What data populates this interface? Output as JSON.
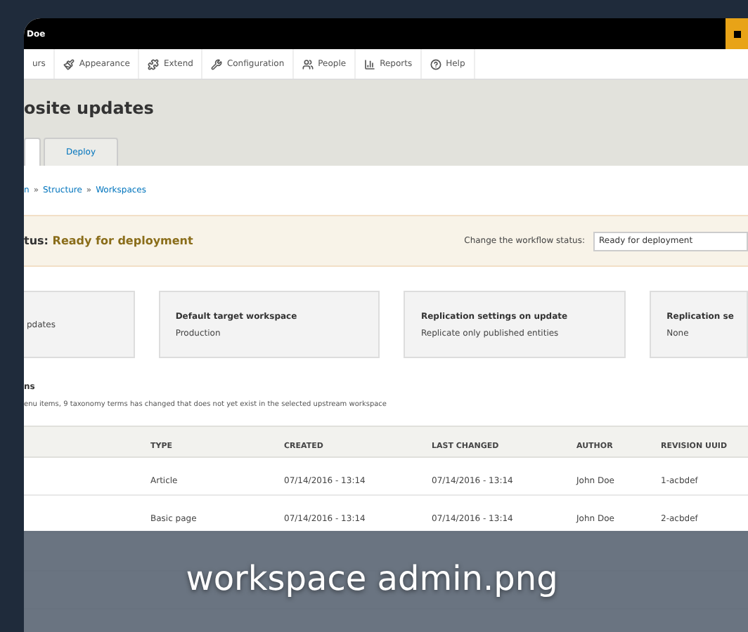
{
  "toolbar": {
    "user": "Doe"
  },
  "menu": [
    {
      "label": "urs"
    },
    {
      "label": "Appearance"
    },
    {
      "label": "Extend"
    },
    {
      "label": "Configuration"
    },
    {
      "label": "People"
    },
    {
      "label": "Reports"
    },
    {
      "label": "Help"
    }
  ],
  "page_title": "osite updates",
  "tabs": [
    {
      "selected": true
    },
    {
      "label": "Deploy",
      "selected": false
    }
  ],
  "breadcrumb": [
    {
      "kind": "link",
      "text": "n"
    },
    {
      "kind": "sep",
      "text": "»"
    },
    {
      "kind": "link",
      "text": "Structure"
    },
    {
      "kind": "sep",
      "text": "»"
    },
    {
      "kind": "link",
      "text": "Workspaces"
    }
  ],
  "status": {
    "label": "tus:",
    "value": "Ready for deployment",
    "change_label": "Change the workflow status:",
    "select_value": "Ready for deployment"
  },
  "cards": [
    {
      "value": "pdates"
    },
    {
      "title": "Default target workspace",
      "value": "Production"
    },
    {
      "title": "Replication settings on update",
      "value": "Replicate only published entities"
    },
    {
      "title": "Replication se",
      "value": "None"
    }
  ],
  "changes": {
    "heading": "ns",
    "description": "enu items, 9 taxonomy terms has changed that does not yet exist in the selected upstream workspace"
  },
  "table": {
    "columns": [
      "",
      "TYPE",
      "CREATED",
      "LAST CHANGED",
      "AUTHOR",
      "REVISION UUID"
    ],
    "rows": [
      [
        "",
        "Article",
        "07/14/2016 - 13:14",
        "07/14/2016 - 13:14",
        "John Doe",
        "1-acbdef"
      ],
      [
        "",
        "Basic page",
        "07/14/2016 - 13:14",
        "07/14/2016 - 13:14",
        "John Doe",
        "2-acbdef"
      ]
    ]
  },
  "caption": "workspace admin.png"
}
